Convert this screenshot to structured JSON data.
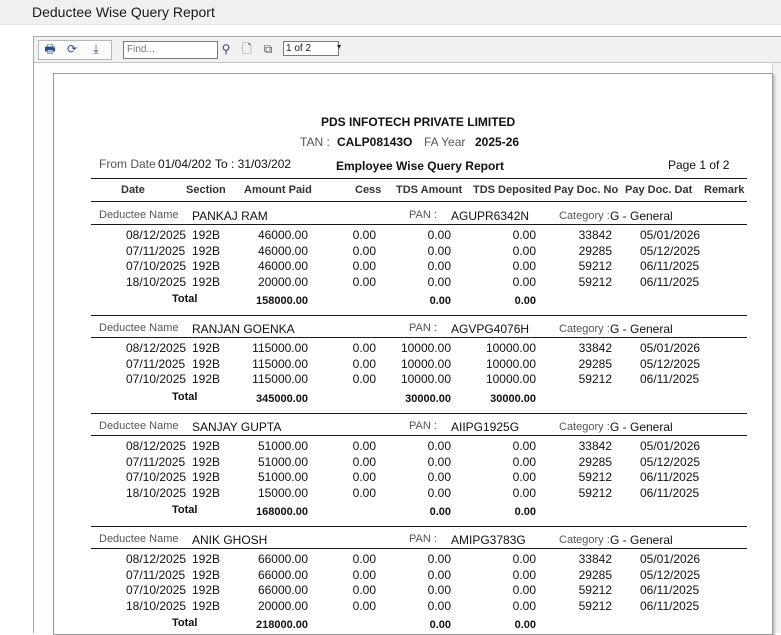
{
  "window": {
    "title": "Deductee Wise Query Report"
  },
  "toolbar": {
    "find_placeholder": "Find...",
    "page_indicator": "1 of 2",
    "page_dropdown_glyph": "▾"
  },
  "report": {
    "company": "PDS INFOTECH PRIVATE LIMITED",
    "tan_label": "TAN :",
    "tan_value": "CALP08143O",
    "fy_label": "FA Year",
    "fy_value": "2025-26",
    "from_label": "From Date",
    "from_value": "01/04/202",
    "to_label": "To : 31/03/202",
    "report_title": "Employee Wise Query Report",
    "page_label": "Page 1 of 2",
    "columns": [
      "Date",
      "Section",
      "Amount Paid",
      "Cess",
      "TDS Amount",
      "TDS Deposited",
      "Pay Doc. No",
      "Pay Doc. Dat",
      "Remark"
    ],
    "deductee_label": "Deductee Name",
    "pan_label": "PAN :",
    "category_label": "Category :",
    "total_label": "Total",
    "groups": [
      {
        "name": "PANKAJ RAM",
        "pan": "AGUPR6342N",
        "category": "G - General",
        "rows": [
          {
            "date": "08/12/2025",
            "section": "192B",
            "amount": "46000.00",
            "cess": "0.00",
            "tds": "0.00",
            "deposited": "0.00",
            "doc_no": "33842",
            "doc_date": "05/01/2026"
          },
          {
            "date": "07/11/2025",
            "section": "192B",
            "amount": "46000.00",
            "cess": "0.00",
            "tds": "0.00",
            "deposited": "0.00",
            "doc_no": "29285",
            "doc_date": "05/12/2025"
          },
          {
            "date": "07/10/2025",
            "section": "192B",
            "amount": "46000.00",
            "cess": "0.00",
            "tds": "0.00",
            "deposited": "0.00",
            "doc_no": "59212",
            "doc_date": "06/11/2025"
          },
          {
            "date": "18/10/2025",
            "section": "192B",
            "amount": "20000.00",
            "cess": "0.00",
            "tds": "0.00",
            "deposited": "0.00",
            "doc_no": "59212",
            "doc_date": "06/11/2025"
          }
        ],
        "total_amount": "158000.00",
        "total_tds": "0.00",
        "total_deposited": "0.00"
      },
      {
        "name": "RANJAN GOENKA",
        "pan": "AGVPG4076H",
        "category": "G - General",
        "rows": [
          {
            "date": "08/12/2025",
            "section": "192B",
            "amount": "115000.00",
            "cess": "0.00",
            "tds": "10000.00",
            "deposited": "10000.00",
            "doc_no": "33842",
            "doc_date": "05/01/2026"
          },
          {
            "date": "07/11/2025",
            "section": "192B",
            "amount": "115000.00",
            "cess": "0.00",
            "tds": "10000.00",
            "deposited": "10000.00",
            "doc_no": "29285",
            "doc_date": "05/12/2025"
          },
          {
            "date": "07/10/2025",
            "section": "192B",
            "amount": "115000.00",
            "cess": "0.00",
            "tds": "10000.00",
            "deposited": "10000.00",
            "doc_no": "59212",
            "doc_date": "06/11/2025"
          }
        ],
        "total_amount": "345000.00",
        "total_tds": "30000.00",
        "total_deposited": "30000.00"
      },
      {
        "name": "SANJAY GUPTA",
        "pan": "AIIPG1925G",
        "category": "G - General",
        "rows": [
          {
            "date": "08/12/2025",
            "section": "192B",
            "amount": "51000.00",
            "cess": "0.00",
            "tds": "0.00",
            "deposited": "0.00",
            "doc_no": "33842",
            "doc_date": "05/01/2026"
          },
          {
            "date": "07/11/2025",
            "section": "192B",
            "amount": "51000.00",
            "cess": "0.00",
            "tds": "0.00",
            "deposited": "0.00",
            "doc_no": "29285",
            "doc_date": "05/12/2025"
          },
          {
            "date": "07/10/2025",
            "section": "192B",
            "amount": "51000.00",
            "cess": "0.00",
            "tds": "0.00",
            "deposited": "0.00",
            "doc_no": "59212",
            "doc_date": "06/11/2025"
          },
          {
            "date": "18/10/2025",
            "section": "192B",
            "amount": "15000.00",
            "cess": "0.00",
            "tds": "0.00",
            "deposited": "0.00",
            "doc_no": "59212",
            "doc_date": "06/11/2025"
          }
        ],
        "total_amount": "168000.00",
        "total_tds": "0.00",
        "total_deposited": "0.00"
      },
      {
        "name": "ANIK GHOSH",
        "pan": "AMIPG3783G",
        "category": "G - General",
        "rows": [
          {
            "date": "08/12/2025",
            "section": "192B",
            "amount": "66000.00",
            "cess": "0.00",
            "tds": "0.00",
            "deposited": "0.00",
            "doc_no": "33842",
            "doc_date": "05/01/2026"
          },
          {
            "date": "07/11/2025",
            "section": "192B",
            "amount": "66000.00",
            "cess": "0.00",
            "tds": "0.00",
            "deposited": "0.00",
            "doc_no": "29285",
            "doc_date": "05/12/2025"
          },
          {
            "date": "07/10/2025",
            "section": "192B",
            "amount": "66000.00",
            "cess": "0.00",
            "tds": "0.00",
            "deposited": "0.00",
            "doc_no": "59212",
            "doc_date": "06/11/2025"
          },
          {
            "date": "18/10/2025",
            "section": "192B",
            "amount": "20000.00",
            "cess": "0.00",
            "tds": "0.00",
            "deposited": "0.00",
            "doc_no": "59212",
            "doc_date": "06/11/2025"
          }
        ],
        "total_amount": "218000.00",
        "total_tds": "0.00",
        "total_deposited": "0.00"
      }
    ]
  }
}
